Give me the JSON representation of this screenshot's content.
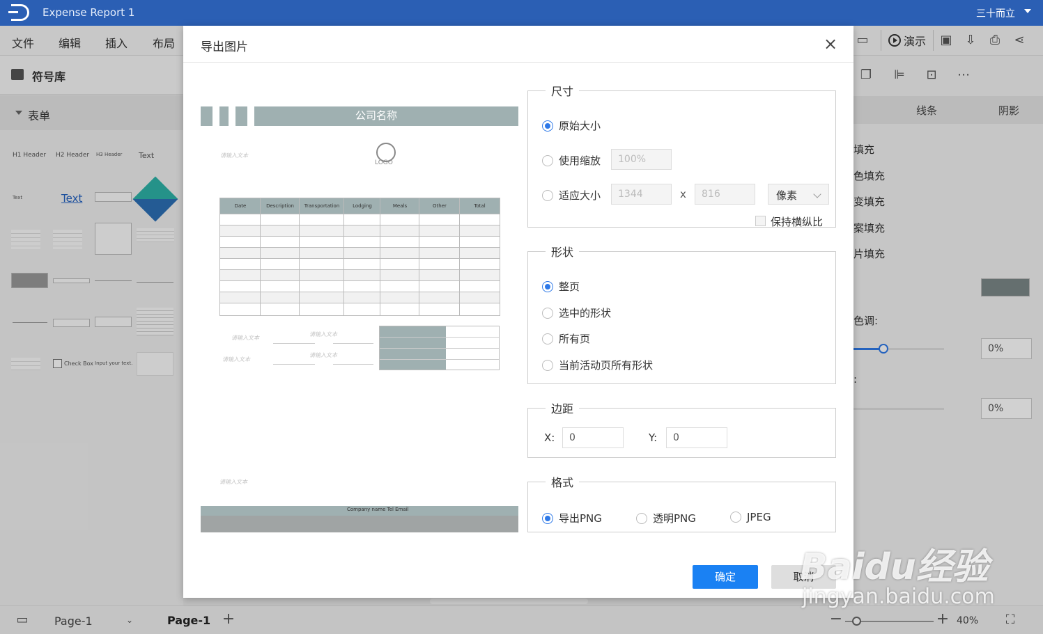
{
  "app": {
    "title": "Expense Report 1",
    "user": "三十而立"
  },
  "menu": [
    "文件",
    "编辑",
    "插入",
    "布局"
  ],
  "toolbar": {
    "present_label": "演示"
  },
  "library": {
    "title": "符号库",
    "category": "表单",
    "thumbs": {
      "h1": "H1 Header",
      "h2": "H2 Header",
      "h3": "H3 Header",
      "text": "Text",
      "text_small": "Text",
      "text_link": "Text",
      "checkbox": "Check Box",
      "input": "Input your text."
    }
  },
  "right_panel": {
    "tabs": [
      "线条",
      "阴影"
    ],
    "fills": [
      "填充",
      "色填充",
      "变填充",
      "案填充",
      "片填充"
    ],
    "hue_label": "色调:",
    "second_label": ":",
    "value1": "0%",
    "value2": "0%",
    "swatch_color": "#7c8888"
  },
  "status": {
    "page_select": "Page-1",
    "page_active": "Page-1",
    "zoom": "40%"
  },
  "dialog": {
    "title": "导出图片",
    "preview": {
      "company": "公司名称",
      "logo": "LOGO",
      "placeholder": "请输入文本",
      "placeholder_short": "请输入文本",
      "columns": [
        "Date",
        "Description",
        "Transportation",
        "Lodging",
        "Meals",
        "Other",
        "Total"
      ],
      "footer": "Company name Tel Email"
    },
    "size": {
      "legend": "尺寸",
      "original": "原始大小",
      "scale": "使用缩放",
      "scale_value": "100%",
      "fit": "适应大小",
      "width": "1344",
      "height": "816",
      "x_sep": "x",
      "unit": "像素",
      "keep_ratio": "保持横纵比"
    },
    "shape": {
      "legend": "形状",
      "options": [
        "整页",
        "选中的形状",
        "所有页",
        "当前活动页所有形状"
      ]
    },
    "margin": {
      "legend": "边距",
      "x_label": "X:",
      "x_value": "0",
      "y_label": "Y:",
      "y_value": "0"
    },
    "format": {
      "legend": "格式",
      "options": [
        "导出PNG",
        "透明PNG",
        "JPEG"
      ]
    },
    "ok": "确定",
    "cancel": "取消"
  },
  "watermark": {
    "brand": "Baidu经验",
    "site": "jingyan.baidu.com"
  }
}
